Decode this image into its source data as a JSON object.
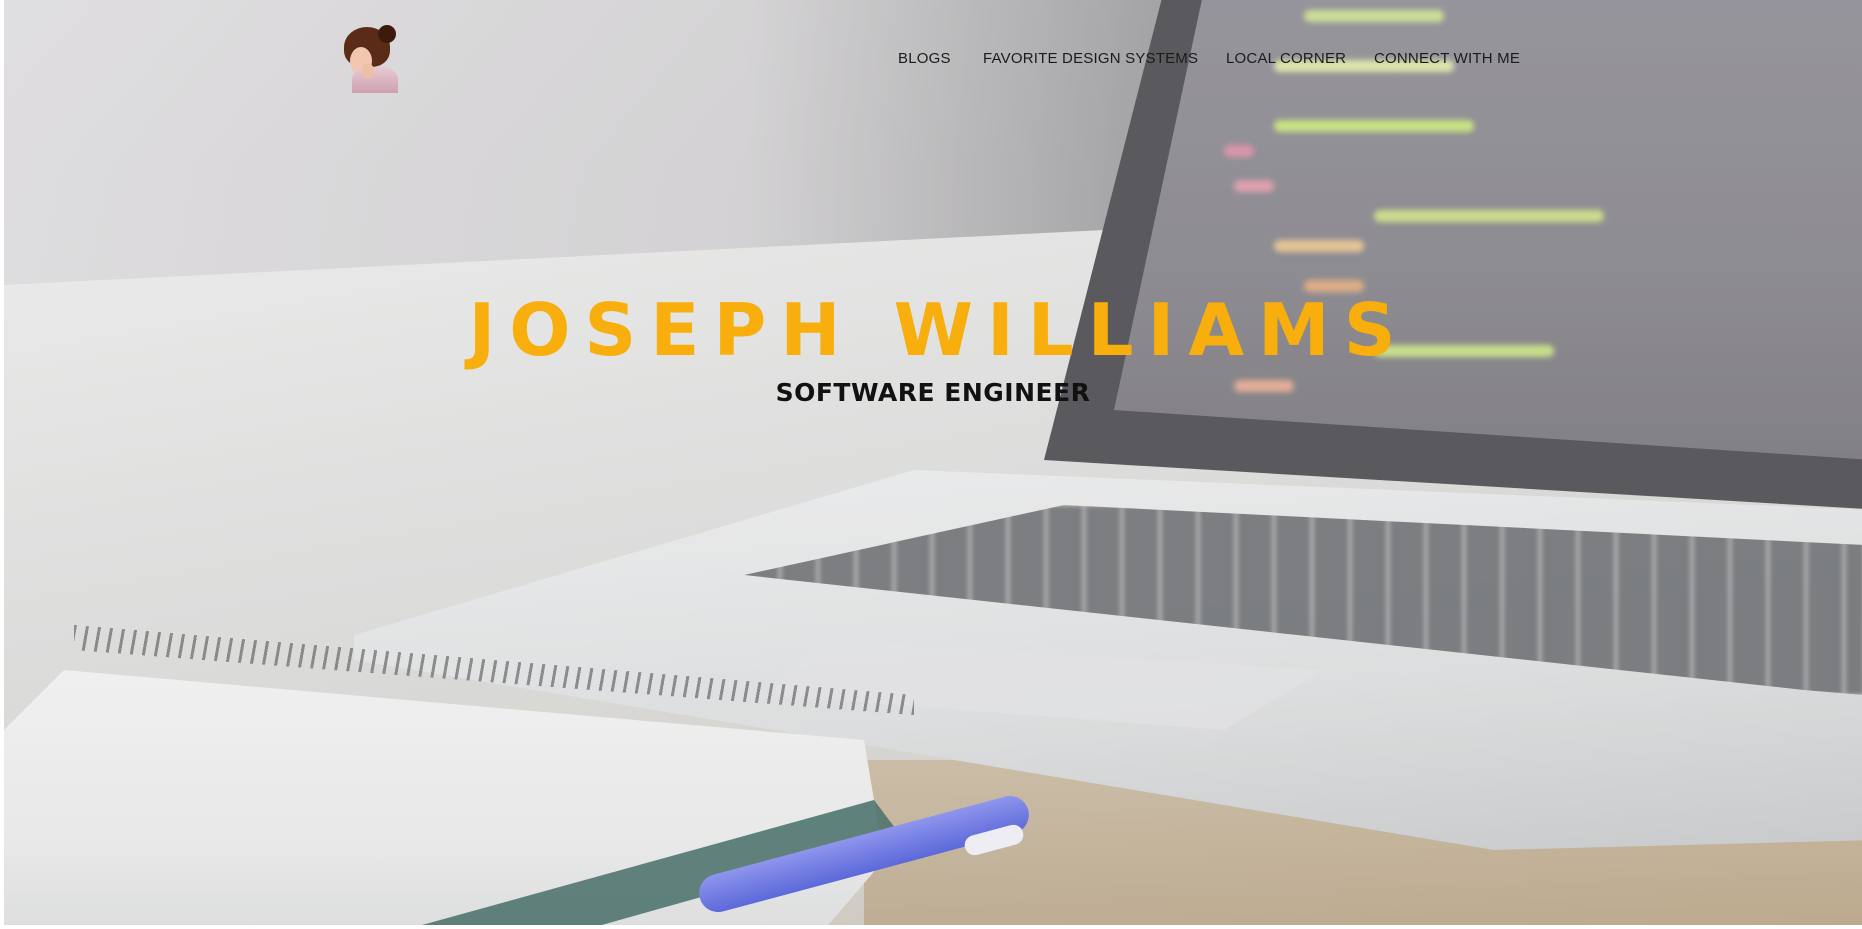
{
  "header": {
    "logo_icon": "vintage-girl-portrait-icon",
    "nav": {
      "items": [
        {
          "label": "BLOGS"
        },
        {
          "label": "FAVORITE DESIGN SYSTEMS"
        },
        {
          "label": "LOCAL CORNER"
        },
        {
          "label": "CONNECT WITH ME"
        }
      ]
    }
  },
  "hero": {
    "name": "JOSEPH WILLIAMS",
    "role": "SOFTWARE ENGINEER",
    "background_image": "laptop-and-notebook-on-desk",
    "accent_color": "#f8ae0c",
    "text_color": "#111111"
  }
}
